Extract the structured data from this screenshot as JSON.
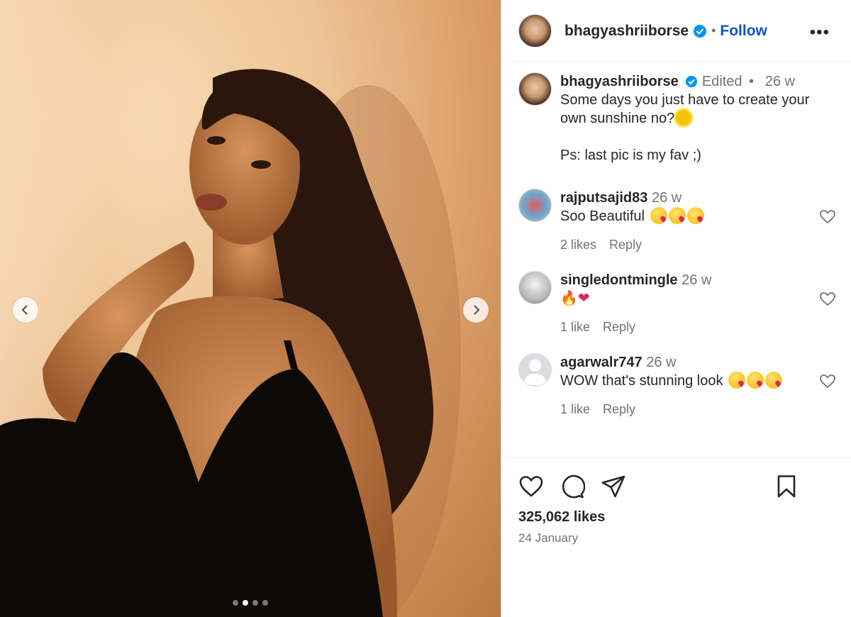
{
  "post": {
    "username": "bhagyashriiborse",
    "follow_label": "Follow",
    "more_label": "•••",
    "separator": "•",
    "caption": {
      "username": "bhagyashriiborse",
      "edited": "Edited",
      "time": "26 w",
      "line1": "Some days you just have to create your own sunshine no?",
      "line2": "Ps: last pic is my fav ;)"
    },
    "comments": [
      {
        "username": "rajputsajid83",
        "time": "26 w",
        "text": "Soo Beautiful",
        "likes": "2 likes",
        "reply": "Reply"
      },
      {
        "username": "singledontmingle",
        "time": "26 w",
        "text": "",
        "likes": "1 like",
        "reply": "Reply"
      },
      {
        "username": "agarwalr747",
        "time": "26 w",
        "text": "WOW that's stunning look",
        "likes": "1 like",
        "reply": "Reply"
      }
    ],
    "likes_count": "325,062 likes",
    "date": "24 January",
    "carousel": {
      "count": 4,
      "active_index": 1
    }
  },
  "colors": {
    "follow": "#0f52c8",
    "verified": "#0095f6",
    "muted": "#737373"
  },
  "icons": [
    "verified-badge-icon",
    "heart-icon",
    "comment-icon",
    "share-icon",
    "bookmark-icon",
    "chevron-left-icon",
    "chevron-right-icon"
  ]
}
